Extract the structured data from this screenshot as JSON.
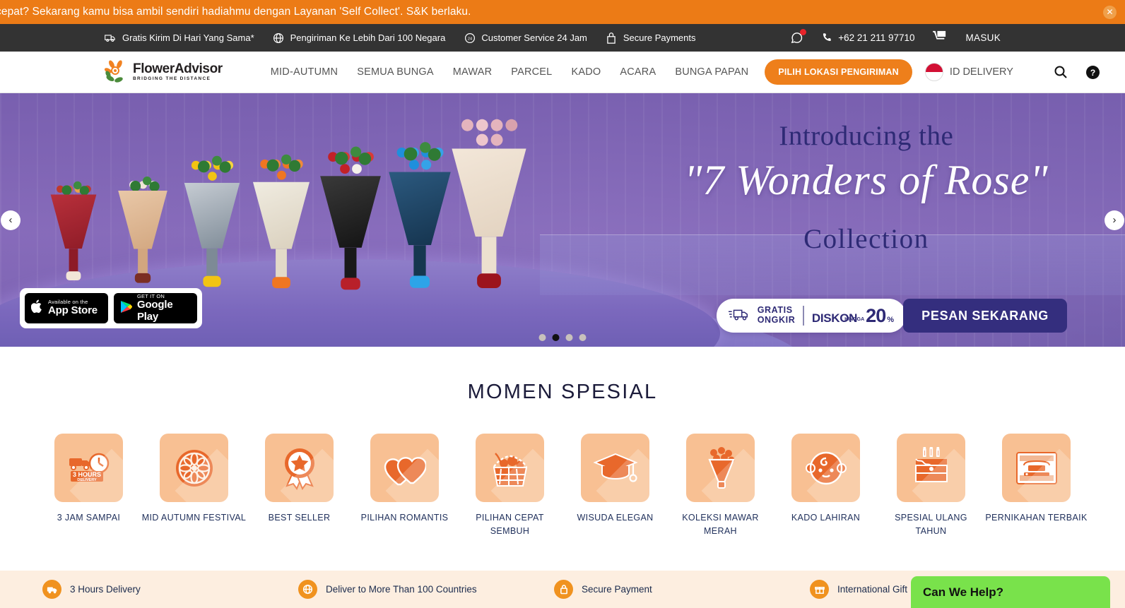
{
  "promo": {
    "text": "cepat? Sekarang kamu bisa ambil sendiri hadiahmu dengan Layanan 'Self Collect'. S&K berlaku.",
    "close_label": "✕",
    "bg_color": "#ec7b16"
  },
  "utility_bar": {
    "items": [
      {
        "icon": "delivery-truck-icon",
        "label": "Gratis Kirim Di Hari Yang Sama*"
      },
      {
        "icon": "globe-icon",
        "label": "Pengiriman Ke Lebih Dari 100 Negara"
      },
      {
        "icon": "support-24-icon",
        "label": "Customer Service 24 Jam"
      },
      {
        "icon": "lock-icon",
        "label": "Secure Payments"
      }
    ],
    "whatsapp_icon": "whatsapp-icon",
    "phone": "+62 21 211 97710",
    "cart_icon": "cart-icon",
    "login_label": "MASUK",
    "bg_color": "#333333"
  },
  "header": {
    "logo_name": "FlowerAdvisor",
    "logo_tagline": "BRIDGING THE DISTANCE",
    "nav": [
      {
        "label": "MID-AUTUMN"
      },
      {
        "label": "SEMUA BUNGA"
      },
      {
        "label": "MAWAR"
      },
      {
        "label": "PARCEL"
      },
      {
        "label": "KADO"
      },
      {
        "label": "ACARA"
      },
      {
        "label": "BUNGA PAPAN"
      }
    ],
    "location_button": "PILIH LOKASI PENGIRIMAN",
    "delivery_label": "ID DELIVERY",
    "search_icon": "search-icon",
    "help_icon": "help-circle-icon",
    "accent_color": "#ee7f1b"
  },
  "hero": {
    "line1": "Introducing the",
    "line2": "\"7 Wonders of Rose\"",
    "line3": "Collection",
    "app_store": {
      "small": "Available on the",
      "big": "App Store"
    },
    "google_play": {
      "small": "GET IT ON",
      "big": "Google Play"
    },
    "promo_pill": {
      "free_line1": "GRATIS",
      "free_line2": "ONGKIR",
      "discount_word": "DISKON",
      "discount_upto": "HINGGA",
      "discount_value": "20",
      "discount_unit": "%"
    },
    "cta_label": "PESAN SEKARANG",
    "prev_arrow": "‹",
    "next_arrow": "›",
    "slides_total": 4,
    "active_slide": 2,
    "bouquets": [
      {
        "name": "red-roses-bouquet",
        "head": "#c0392b",
        "wrap": "#a41f2b",
        "bow": "#f2e6d8"
      },
      {
        "name": "white-roses-bouquet",
        "head": "#f4ece0",
        "wrap": "#e0bfa0",
        "bow": "#7b2e23"
      },
      {
        "name": "yellow-roses-bouquet",
        "head": "#f2c413",
        "wrap": "#8e9aa6",
        "bow": "#f2c413"
      },
      {
        "name": "orange-roses-bouquet",
        "head": "#ef7622",
        "wrap": "#e8e2d4",
        "bow": "#ef7622"
      },
      {
        "name": "red-roses-black-wrap-bouquet",
        "head": "#c22127",
        "wrap": "#2b2b2b",
        "bow": "#b8202a"
      },
      {
        "name": "blue-roses-bouquet",
        "head": "#1f8fdc",
        "wrap": "#1d3e5c",
        "bow": "#2da4e8"
      },
      {
        "name": "pink-roses-bouquet",
        "head": "#e4b4bd",
        "wrap": "#efe0d2",
        "bow": "#a01820"
      }
    ]
  },
  "momen_spesial": {
    "title": "MOMEN SPESIAL",
    "categories": [
      {
        "icon": "three-hours-delivery-icon",
        "label": "3 JAM SAMPAI"
      },
      {
        "icon": "mooncake-icon",
        "label": "MID AUTUMN FESTIVAL"
      },
      {
        "icon": "award-ribbon-icon",
        "label": "BEST SELLER"
      },
      {
        "icon": "two-hearts-icon",
        "label": "PILIHAN ROMANTIS"
      },
      {
        "icon": "fruit-basket-icon",
        "label": "PILIHAN CEPAT SEMBUH"
      },
      {
        "icon": "graduation-cap-icon",
        "label": "WISUDA ELEGAN"
      },
      {
        "icon": "rose-bouquet-icon",
        "label": "KOLEKSI MAWAR MERAH"
      },
      {
        "icon": "baby-face-icon",
        "label": "KADO LAHIRAN"
      },
      {
        "icon": "birthday-cake-icon",
        "label": "SPESIAL ULANG TAHUN"
      },
      {
        "icon": "wedding-card-icon",
        "label": "PERNIKAHAN TERBAIK"
      }
    ],
    "tile_color": "#f8c093",
    "icon_color": "#e8682b"
  },
  "features": [
    {
      "icon": "three-hours-icon",
      "label": "3 Hours Delivery"
    },
    {
      "icon": "globe-delivery-icon",
      "label": "Deliver to More Than 100 Countries"
    },
    {
      "icon": "lock-payment-icon",
      "label": "Secure Payment"
    },
    {
      "icon": "international-gift-icon",
      "label": "International Gift"
    }
  ],
  "chat": {
    "title": "Can We Help?",
    "bg_color": "#79e24b"
  }
}
